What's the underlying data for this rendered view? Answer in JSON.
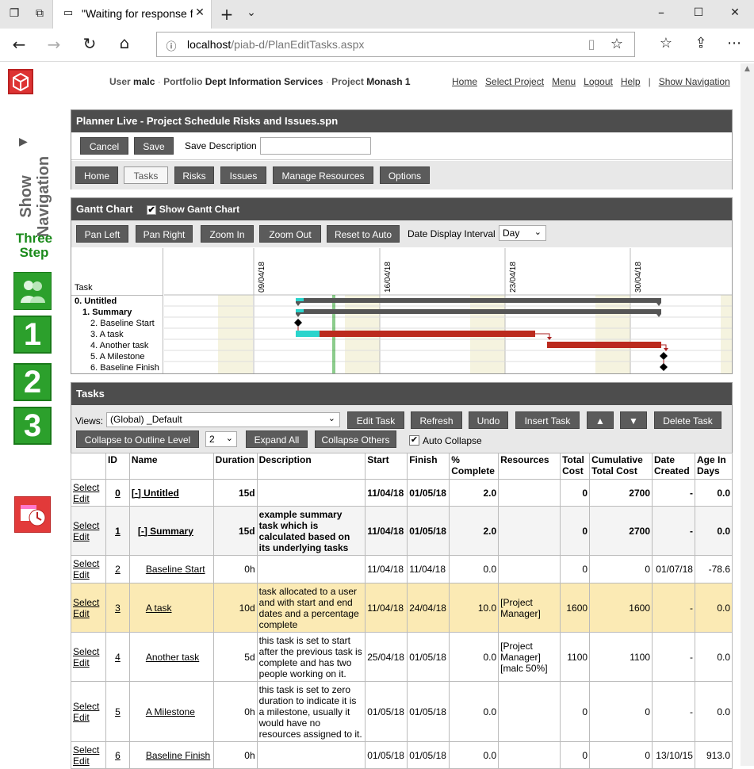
{
  "browser": {
    "tab_title": "\"Waiting for response fr",
    "url_host": "localhost",
    "url_path": "/piab-d/PlanEditTasks.aspx"
  },
  "header": {
    "user_label": "User",
    "user": "malc",
    "portfolio_label": "Portfolio",
    "portfolio": "Dept Information Services",
    "project_label": "Project",
    "project": "Monash 1",
    "links": [
      "Home",
      "Select Project",
      "Menu",
      "Logout",
      "Help",
      "Show Navigation"
    ],
    "sep": "|"
  },
  "sidebar": {
    "show_nav": "Show Navigation",
    "three_step": "Three Step",
    "steps": [
      "1",
      "2",
      "3"
    ]
  },
  "planner": {
    "title": "Planner Live - Project Schedule Risks and Issues.spn",
    "cancel": "Cancel",
    "save": "Save",
    "save_desc_label": "Save Description",
    "save_desc_value": "",
    "nav": [
      "Home",
      "Tasks",
      "Risks",
      "Issues",
      "Manage Resources",
      "Options"
    ]
  },
  "gantt": {
    "title": "Gantt Chart",
    "show_label": "Show Gantt Chart",
    "buttons": [
      "Pan Left",
      "Pan Right",
      "Zoom In",
      "Zoom Out",
      "Reset to Auto"
    ],
    "interval_label": "Date Display Interval",
    "interval_value": "Day",
    "task_col": "Task",
    "dates": [
      "09/04/18",
      "16/04/18",
      "23/04/18",
      "30/04/18"
    ],
    "rows": [
      "0. Untitled",
      "1. Summary",
      "2. Baseline Start",
      "3. A task",
      "4. Another task",
      "5. A Milestone",
      "6. Baseline Finish"
    ]
  },
  "tasks": {
    "title": "Tasks",
    "views_label": "Views:",
    "views_value": "(Global) _Default",
    "buttons": [
      "Edit Task",
      "Refresh",
      "Undo",
      "Insert Task",
      "▲",
      "▼",
      "Delete Task"
    ],
    "collapse_level": "Collapse to Outline Level",
    "level_value": "2",
    "expand_all": "Expand All",
    "collapse_others": "Collapse Others",
    "auto_collapse": "Auto Collapse",
    "columns": [
      "ID",
      "Name",
      "Duration",
      "Description",
      "Start",
      "Finish",
      "% Complete",
      "Resources",
      "Total Cost",
      "Cumulative Total Cost",
      "Date Created",
      "Age In Days"
    ],
    "select": "Select",
    "edit": "Edit",
    "rows": [
      {
        "id": "0",
        "name": "[-] Untitled",
        "duration": "15d",
        "description": "",
        "start": "11/04/18",
        "finish": "01/05/18",
        "complete": "2.0",
        "resources": "",
        "cost": "0",
        "cum": "2700",
        "created": "-",
        "age": "0.0"
      },
      {
        "id": "1",
        "name": "[-] Summary",
        "duration": "15d",
        "description": "example summary task which is calculated based on its underlying tasks",
        "start": "11/04/18",
        "finish": "01/05/18",
        "complete": "2.0",
        "resources": "",
        "cost": "0",
        "cum": "2700",
        "created": "-",
        "age": "0.0"
      },
      {
        "id": "2",
        "name": "Baseline Start",
        "duration": "0h",
        "description": "",
        "start": "11/04/18",
        "finish": "11/04/18",
        "complete": "0.0",
        "resources": "",
        "cost": "0",
        "cum": "0",
        "created": "01/07/18",
        "age": "-78.6"
      },
      {
        "id": "3",
        "name": "A task",
        "duration": "10d",
        "description": "task allocated to a user and with start and end dates and a percentage complete",
        "start": "11/04/18",
        "finish": "24/04/18",
        "complete": "10.0",
        "resources": "[Project Manager]",
        "cost": "1600",
        "cum": "1600",
        "created": "-",
        "age": "0.0"
      },
      {
        "id": "4",
        "name": "Another task",
        "duration": "5d",
        "description": "this task is set to start after the previous task is complete and has two people working on it.",
        "start": "25/04/18",
        "finish": "01/05/18",
        "complete": "0.0",
        "resources": "[Project Manager] [malc 50%]",
        "cost": "1100",
        "cum": "1100",
        "created": "-",
        "age": "0.0"
      },
      {
        "id": "5",
        "name": "A Milestone",
        "duration": "0h",
        "description": "this task is set to zero duration to indicate it is a milestone, usually it would have no resources assigned to it.",
        "start": "01/05/18",
        "finish": "01/05/18",
        "complete": "0.0",
        "resources": "",
        "cost": "0",
        "cum": "0",
        "created": "-",
        "age": "0.0"
      },
      {
        "id": "6",
        "name": "Baseline Finish",
        "duration": "0h",
        "description": "",
        "start": "01/05/18",
        "finish": "01/05/18",
        "complete": "0.0",
        "resources": "",
        "cost": "0",
        "cum": "0",
        "created": "13/10/15",
        "age": "913.0"
      }
    ]
  }
}
